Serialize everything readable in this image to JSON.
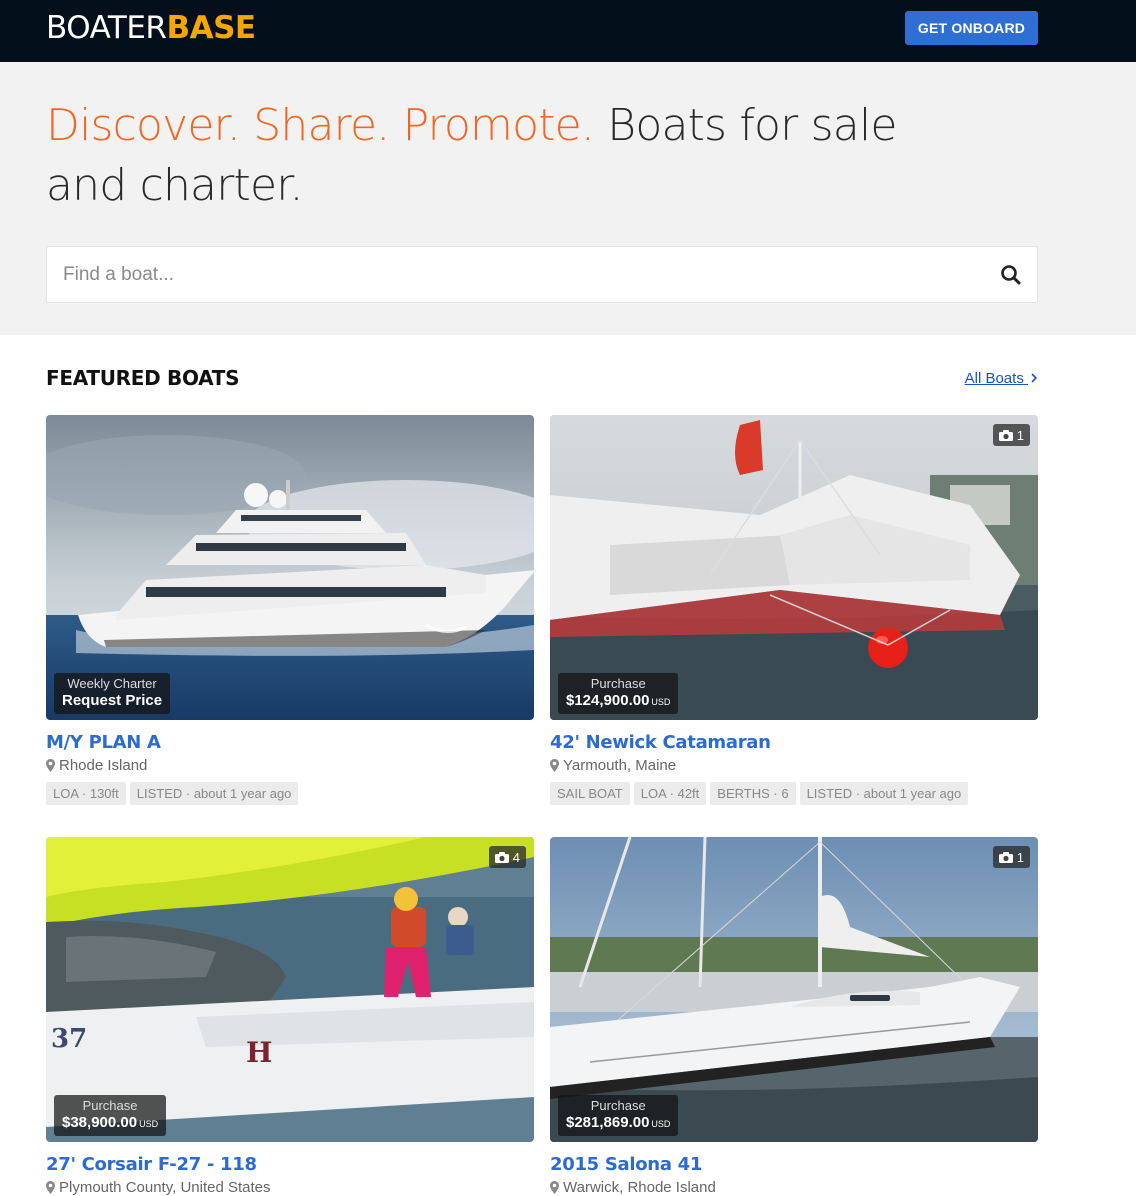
{
  "header": {
    "logo_part1": "BOATER",
    "logo_part2": "BASE",
    "cta_label": "GET ONBOARD"
  },
  "hero": {
    "headline_highlight": "Discover. Share. Promote.",
    "headline_rest": " Boats for sale and charter.",
    "search_placeholder": "Find a boat..."
  },
  "featured": {
    "title": "FEATURED BOATS",
    "all_link": "All Boats",
    "cards": [
      {
        "title": "M/Y PLAN A",
        "location": "Rhode Island",
        "price_kind": "Weekly Charter",
        "price_value": "Request Price",
        "price_currency": "",
        "photo_count": "",
        "tags": [
          "LOA · 130ft",
          "LISTED · about 1 year ago"
        ]
      },
      {
        "title": "42' Newick Catamaran",
        "location": "Yarmouth, Maine",
        "price_kind": "Purchase",
        "price_value": "$124,900.00",
        "price_currency": "USD",
        "photo_count": "1",
        "tags": [
          "SAIL BOAT",
          "LOA · 42ft",
          "BERTHS · 6",
          "LISTED · about 1 year ago"
        ]
      },
      {
        "title": "27' Corsair F-27 - 118",
        "location": "Plymouth County, United States",
        "price_kind": "Purchase",
        "price_value": "$38,900.00",
        "price_currency": "USD",
        "photo_count": "4",
        "tags": []
      },
      {
        "title": "2015 Salona 41",
        "location": "Warwick, Rhode Island",
        "price_kind": "Purchase",
        "price_value": "$281,869.00",
        "price_currency": "USD",
        "photo_count": "1",
        "tags": []
      }
    ]
  },
  "colors": {
    "topbar": "#040f1c",
    "brand_accent": "#f7a600",
    "headline_accent": "#f26522",
    "link_blue": "#2c6bd0",
    "button_blue": "#2f6fd3"
  },
  "icons": [
    "search-icon",
    "camera-icon",
    "map-marker-icon",
    "chevron-right-icon"
  ]
}
